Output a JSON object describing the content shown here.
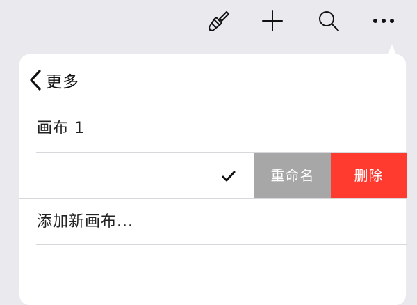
{
  "toolbar": {
    "items": [
      {
        "icon": "paintbrush-icon"
      },
      {
        "icon": "plus-icon"
      },
      {
        "icon": "search-icon"
      },
      {
        "icon": "more-icon"
      }
    ]
  },
  "popover": {
    "back_label": "更多",
    "items": [
      {
        "label": "画布 1"
      },
      {
        "label": "",
        "checked": true
      },
      {
        "label": "添加新画布..."
      }
    ],
    "swipe_actions": [
      {
        "label": "重命名",
        "color": "#a7a7a7"
      },
      {
        "label": "删除",
        "color": "#ff3b30"
      }
    ]
  }
}
